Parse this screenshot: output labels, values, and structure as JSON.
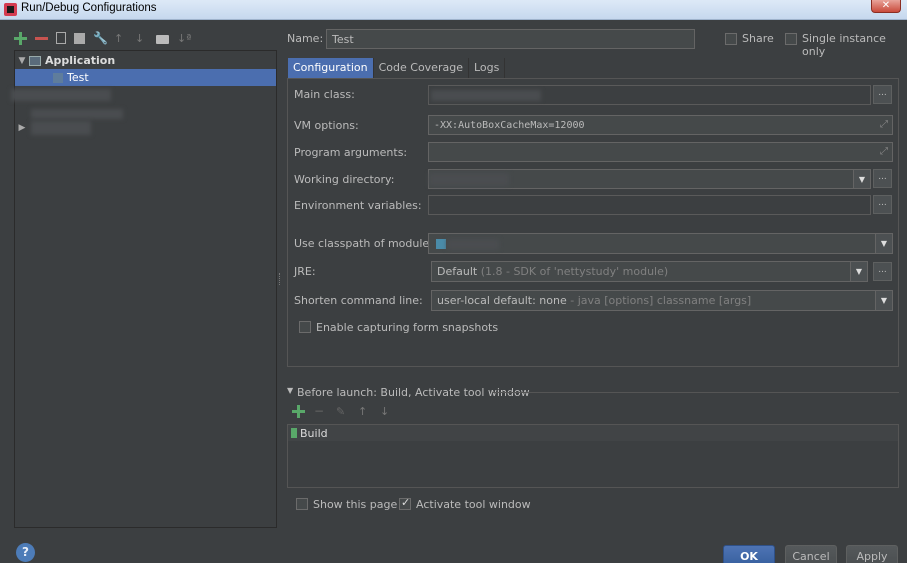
{
  "window": {
    "title": "Run/Debug Configurations",
    "close_glyph": "✕"
  },
  "toolbar": {
    "add": "+",
    "remove": "−",
    "wrench": "🔧",
    "up": "↑",
    "down": "↓",
    "sort": "↓ª"
  },
  "tree": {
    "root_label": "Application",
    "selected_label": "Test",
    "expand_glyph": "▼",
    "collapsed_glyph": "▶"
  },
  "header": {
    "name_label": "Name:",
    "name_value": "Test",
    "share_label": "Share",
    "single_instance_label": "Single instance only"
  },
  "tabs": [
    "Configuration",
    "Code Coverage",
    "Logs"
  ],
  "form": {
    "main_class_label": "Main class:",
    "vm_options_label": "VM options:",
    "vm_options_value": "-XX:AutoBoxCacheMax=12000",
    "program_args_label": "Program arguments:",
    "working_dir_label": "Working directory:",
    "env_vars_label": "Environment variables:",
    "classpath_label": "Use classpath of module",
    "jre_label": "JRE:",
    "jre_value": "Default",
    "jre_hint": "(1.8 - SDK of 'nettystudy' module)",
    "shorten_label": "Shorten command line:",
    "shorten_value": "user-local default: none",
    "shorten_hint": "- java [options] classname [args]",
    "snapshots_label": "Enable capturing form snapshots",
    "browse_glyph": "...",
    "expand_glyph": "⤢",
    "dropdown_glyph": "▼"
  },
  "before_launch": {
    "header": "Before launch: Build, Activate tool window",
    "item": "Build",
    "caret": "▼"
  },
  "footer": {
    "show_page_label": "Show this page",
    "activate_label": "Activate tool window",
    "ok": "OK",
    "cancel": "Cancel",
    "apply": "Apply",
    "help": "?"
  }
}
